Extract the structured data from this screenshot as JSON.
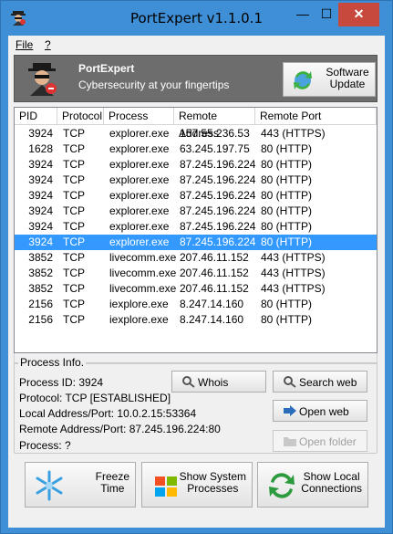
{
  "window": {
    "title": "PortExpert v1.1.0.1"
  },
  "controls": {
    "minimize": "—",
    "maximize": "☐",
    "close": "✕"
  },
  "menu": {
    "file": "File",
    "help": "?"
  },
  "banner": {
    "name": "PortExpert",
    "tagline": "Cybersecurity at your fingertips",
    "update_line1": "Software",
    "update_line2": "Update"
  },
  "table": {
    "headers": [
      "PID",
      "Protocol",
      "Process",
      "Remote Address",
      "Remote Port"
    ],
    "rows": [
      {
        "pid": "3924",
        "protocol": "TCP",
        "process": "explorer.exe",
        "address": "157.55.236.53",
        "port": "443 (HTTPS)"
      },
      {
        "pid": "1628",
        "protocol": "TCP",
        "process": "explorer.exe",
        "address": "63.245.197.75",
        "port": "80 (HTTP)"
      },
      {
        "pid": "3924",
        "protocol": "TCP",
        "process": "explorer.exe",
        "address": "87.245.196.224",
        "port": "80 (HTTP)"
      },
      {
        "pid": "3924",
        "protocol": "TCP",
        "process": "explorer.exe",
        "address": "87.245.196.224",
        "port": "80 (HTTP)"
      },
      {
        "pid": "3924",
        "protocol": "TCP",
        "process": "explorer.exe",
        "address": "87.245.196.224",
        "port": "80 (HTTP)"
      },
      {
        "pid": "3924",
        "protocol": "TCP",
        "process": "explorer.exe",
        "address": "87.245.196.224",
        "port": "80 (HTTP)"
      },
      {
        "pid": "3924",
        "protocol": "TCP",
        "process": "explorer.exe",
        "address": "87.245.196.224",
        "port": "80 (HTTP)"
      },
      {
        "pid": "3924",
        "protocol": "TCP",
        "process": "explorer.exe",
        "address": "87.245.196.224",
        "port": "80 (HTTP)"
      },
      {
        "pid": "3852",
        "protocol": "TCP",
        "process": "livecomm.exe",
        "address": "207.46.11.152",
        "port": "443 (HTTPS)"
      },
      {
        "pid": "3852",
        "protocol": "TCP",
        "process": "livecomm.exe",
        "address": "207.46.11.152",
        "port": "443 (HTTPS)"
      },
      {
        "pid": "3852",
        "protocol": "TCP",
        "process": "livecomm.exe",
        "address": "207.46.11.152",
        "port": "443 (HTTPS)"
      },
      {
        "pid": "2156",
        "protocol": "TCP",
        "process": "iexplore.exe",
        "address": "8.247.14.160",
        "port": "80 (HTTP)"
      },
      {
        "pid": "2156",
        "protocol": "TCP",
        "process": "iexplore.exe",
        "address": "8.247.14.160",
        "port": "80 (HTTP)"
      }
    ],
    "selected_row": 7
  },
  "process_info": {
    "title": "Process Info.",
    "process_id": "Process ID: 3924",
    "protocol": "Protocol: TCP [ESTABLISHED]",
    "local": "Local Address/Port: 10.0.2.15:53364",
    "remote": "Remote Address/Port: 87.245.196.224:80",
    "process": "Process: ?"
  },
  "buttons": {
    "whois": "Whois",
    "search_web": "Search web",
    "open_web": "Open web",
    "open_folder": "Open folder",
    "freeze_1": "Freeze",
    "freeze_2": "Time",
    "system_1": "Show System",
    "system_2": "Processes",
    "local_1": "Show Local",
    "local_2": "Connections"
  },
  "colors": {
    "titlebar": "#3f8fd6",
    "close": "#c7483d",
    "selection": "#3399ff",
    "banner": "#6d6d6d"
  }
}
